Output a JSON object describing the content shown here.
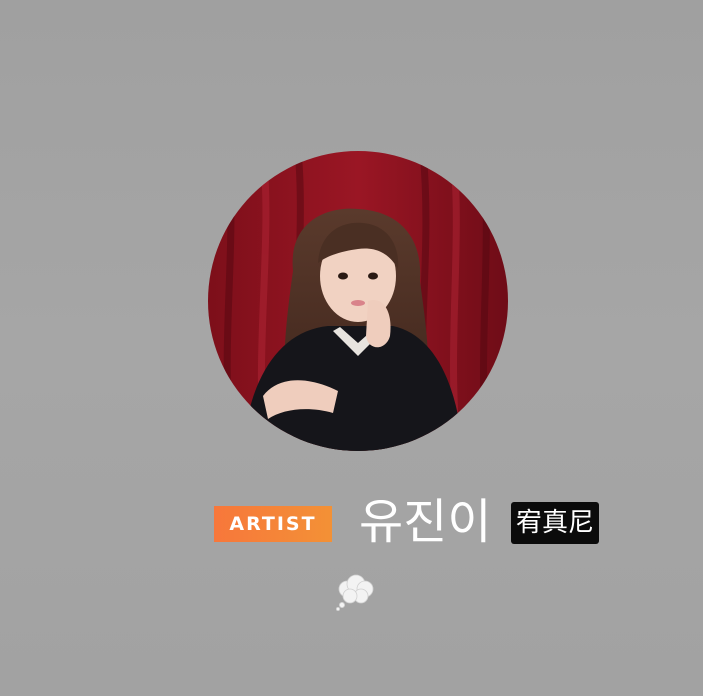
{
  "profile": {
    "avatar_icon": "profile-photo",
    "badge_label": "ARTIST",
    "display_name": "유진이",
    "alt_name": "宥真尼",
    "status_icon": "thought-bubble-icon"
  },
  "colors": {
    "background": "#a3a3a3",
    "badge_start": "#f7773b",
    "badge_end": "#f39136",
    "name_text": "#ffffff",
    "alt_name_bg": "#0b0b0b"
  }
}
